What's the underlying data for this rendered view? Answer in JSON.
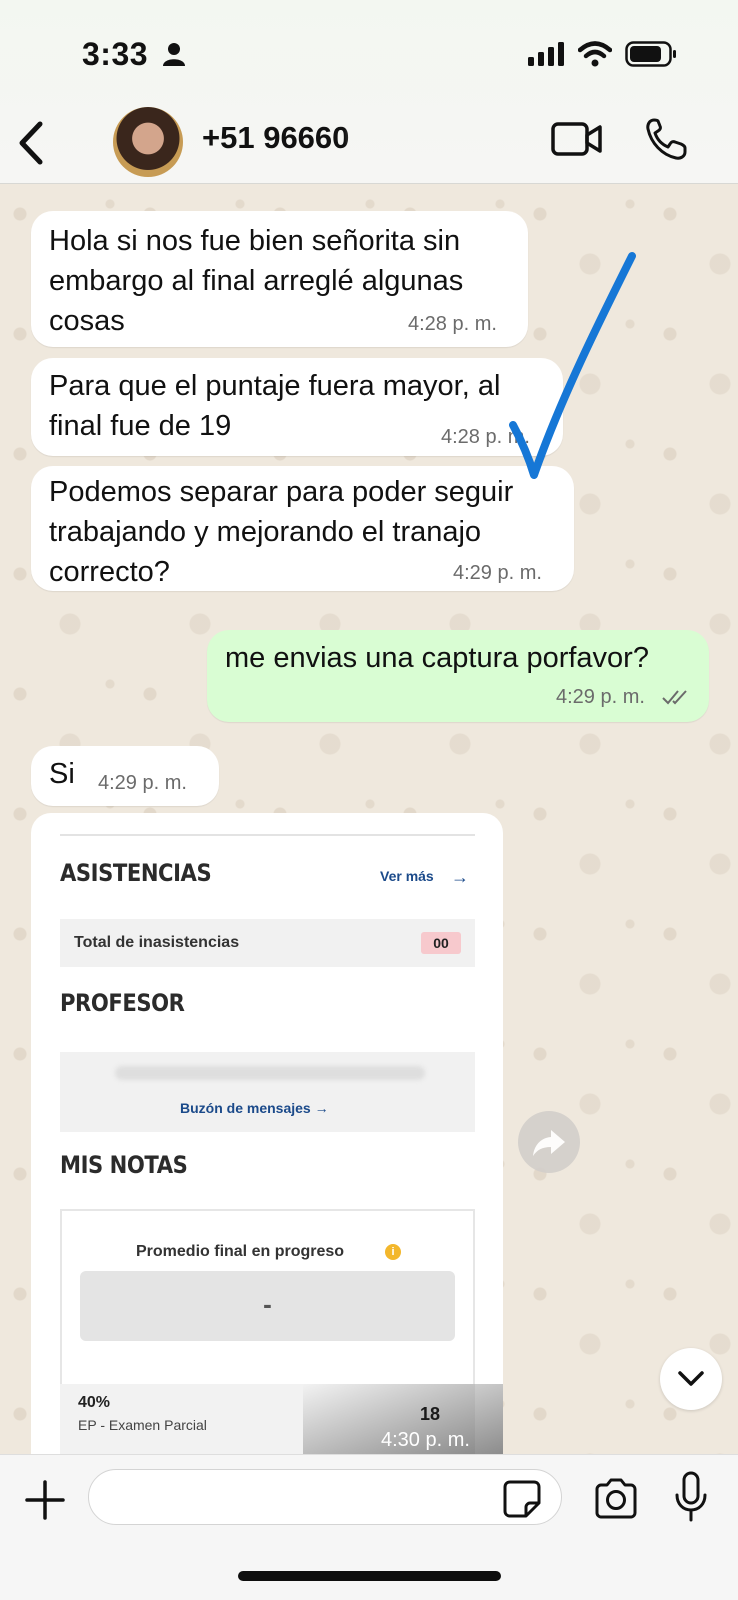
{
  "status_bar": {
    "time": "3:33",
    "icons": [
      "person-icon",
      "cellular-signal-icon",
      "wifi-icon",
      "battery-icon"
    ]
  },
  "header": {
    "back_icon": "chevron-left-icon",
    "contact_name": "+51 96660",
    "actions": [
      "video-call-icon",
      "voice-call-icon"
    ]
  },
  "messages": [
    {
      "direction": "in",
      "text_lines": [
        "Hola si nos fue bien señorita sin",
        "embargo al final arreglé algunas",
        "cosas"
      ],
      "time": "4:28 p. m."
    },
    {
      "direction": "in",
      "text_lines": [
        "Para que el puntaje fuera mayor, al",
        "final fue de 19"
      ],
      "time": "4:28 p. m."
    },
    {
      "direction": "in",
      "text_lines": [
        "Podemos separar para poder seguir",
        "trabajando y mejorando el tranajo",
        "correcto?"
      ],
      "time": "4:29 p. m."
    },
    {
      "direction": "out",
      "text_lines": [
        "me envias una captura porfavor?"
      ],
      "time": "4:29 p. m.",
      "status": "read-double-check"
    },
    {
      "direction": "in",
      "text_lines": [
        "Si"
      ],
      "time": "4:29 p. m."
    }
  ],
  "image_message": {
    "time": "4:30 p. m.",
    "asistencias": {
      "title": "ASISTENCIAS",
      "ver_mas": "Ver más",
      "label": "Total de inasistencias",
      "value": "00"
    },
    "profesor": {
      "title": "PROFESOR",
      "buzon": "Buzón de mensajes →"
    },
    "mis_notas": {
      "title": "MIS NOTAS",
      "promedio_label": "Promedio final en progreso",
      "promedio_value": "-",
      "row_percent": "40%",
      "row_name": "EP - Examen Parcial",
      "row_value": "18"
    }
  },
  "composer": {
    "placeholder": "",
    "icons": [
      "plus-icon",
      "sticker-icon",
      "camera-icon",
      "microphone-icon"
    ]
  },
  "colors": {
    "incoming_bubble": "#ffffff",
    "outgoing_bubble": "#d9fdd3",
    "chat_background": "#efe8dd",
    "annotation_stroke": "#1677d6",
    "link_blue": "#1b4a8a"
  }
}
